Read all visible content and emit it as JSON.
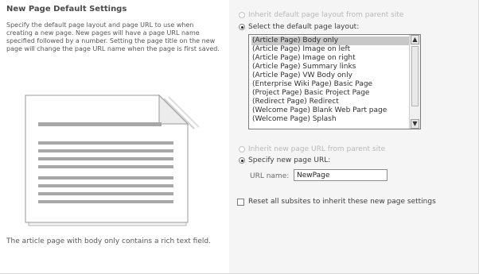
{
  "section": {
    "title": "New Page Default Settings",
    "description": "Specify the default page layout and page URL to use when creating a new page. New pages will have a page URL name specified followed by a number. Setting the page title on the new page will change the page URL name when the page is first saved."
  },
  "preview": {
    "description": "The article page with body only contains a rich text field."
  },
  "layout": {
    "inherit_label": "Inherit default page layout from parent site",
    "select_label": "Select the default page layout:",
    "options": [
      "(Article Page) Body only",
      "(Article Page) Image on left",
      "(Article Page) Image on right",
      "(Article Page) Summary links",
      "(Article Page) VW Body only",
      "(Enterprise Wiki Page) Basic Page",
      "(Project Page) Basic Project Page",
      "(Redirect Page) Redirect",
      "(Welcome Page) Blank Web Part page",
      "(Welcome Page) Splash"
    ],
    "selected_index": 0
  },
  "url": {
    "inherit_label": "Inherit new page URL from parent site",
    "specify_label": "Specify new page URL:",
    "name_label": "URL name:",
    "name_value": "NewPage"
  },
  "reset": {
    "label": "Reset all subsites to inherit these new page settings"
  },
  "colors": {
    "right_panel_bg": "#f5f5f5",
    "selected_item_bg": "#c8c8c8"
  }
}
